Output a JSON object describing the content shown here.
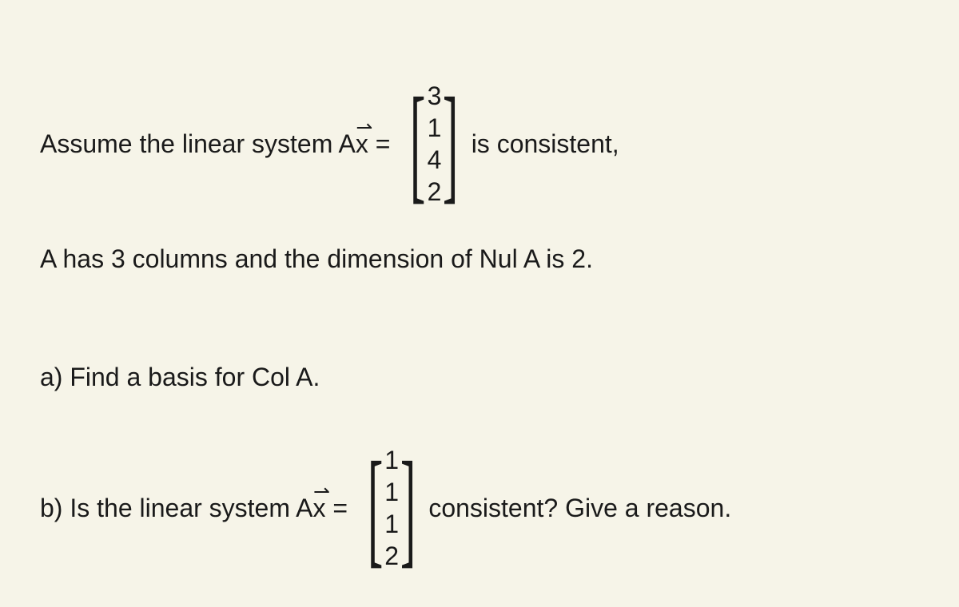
{
  "preamble": {
    "text1": "Assume the linear system A",
    "x": "x",
    "equals": " = ",
    "text2": " is consistent,"
  },
  "vector1": {
    "v1": "3",
    "v2": "1",
    "v3": "4",
    "v4": "2"
  },
  "conditions": "A has 3 columns and the dimension of Nul A is 2.",
  "partA": "a) Find a basis for Col A.",
  "partB": {
    "text1": "b) Is the linear system A",
    "x": "x",
    "equals": " = ",
    "text2": " consistent? Give a reason."
  },
  "vector2": {
    "v1": "1",
    "v2": "1",
    "v3": "1",
    "v4": "2"
  }
}
